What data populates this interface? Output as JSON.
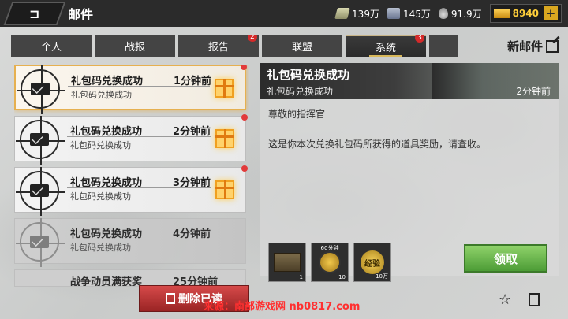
{
  "header": {
    "back_label": "⊐",
    "title": "邮件",
    "resources": [
      {
        "icon": "cash-icon",
        "value": "139万"
      },
      {
        "icon": "supply-box-icon",
        "value": "145万"
      },
      {
        "icon": "oil-drop-icon",
        "value": "91.9万"
      }
    ],
    "gold": {
      "icon": "gold-bar-icon",
      "value": "8940",
      "plus": "+"
    }
  },
  "tabs": [
    {
      "label": "个人",
      "badge": ""
    },
    {
      "label": "战报",
      "badge": ""
    },
    {
      "label": "报告",
      "badge": "2"
    },
    {
      "label": "联盟",
      "badge": ""
    },
    {
      "label": "系统",
      "badge": "3",
      "active": true
    },
    {
      "label": "已发",
      "badge": ""
    }
  ],
  "new_mail_label": "新邮件",
  "mails": [
    {
      "title": "礼包码兑换成功",
      "time": "1分钟前",
      "subtitle": "礼包码兑换成功",
      "has_gift": true,
      "unread": true,
      "selected": true
    },
    {
      "title": "礼包码兑换成功",
      "time": "2分钟前",
      "subtitle": "礼包码兑换成功",
      "has_gift": true,
      "unread": true
    },
    {
      "title": "礼包码兑换成功",
      "time": "3分钟前",
      "subtitle": "礼包码兑换成功",
      "has_gift": true,
      "unread": true
    },
    {
      "title": "礼包码兑换成功",
      "time": "4分钟前",
      "subtitle": "礼包码兑换成功",
      "has_gift": false,
      "unread": false
    },
    {
      "title": "战争动员满获奖",
      "time": "25分钟前",
      "subtitle": "",
      "has_gift": false,
      "unread": false
    }
  ],
  "detail": {
    "title": "礼包码兑换成功",
    "subtitle": "礼包码兑换成功",
    "time": "2分钟前",
    "greeting": "尊敬的指挥官",
    "body": "这是你本次兑换礼包码所获得的道具奖励，请查收。",
    "rewards": [
      {
        "icon": "supply-crate-icon",
        "qty": "1",
        "top_label": ""
      },
      {
        "icon": "speedup-icon",
        "qty": "10",
        "top_label": "60分钟"
      },
      {
        "icon": "exp-icon",
        "qty": "10万",
        "top_label": "",
        "text": "经验"
      }
    ],
    "claim_label": "领取"
  },
  "footer": {
    "delete_read_label": "删除已读",
    "star_icon": "☆",
    "watermark": "来源：南部游戏网 nb0817.com"
  },
  "colors": {
    "accent_gold": "#d8b85a",
    "claim_green": "#4c9c36",
    "delete_red": "#9a2424",
    "badge_red": "#d52a2a"
  }
}
